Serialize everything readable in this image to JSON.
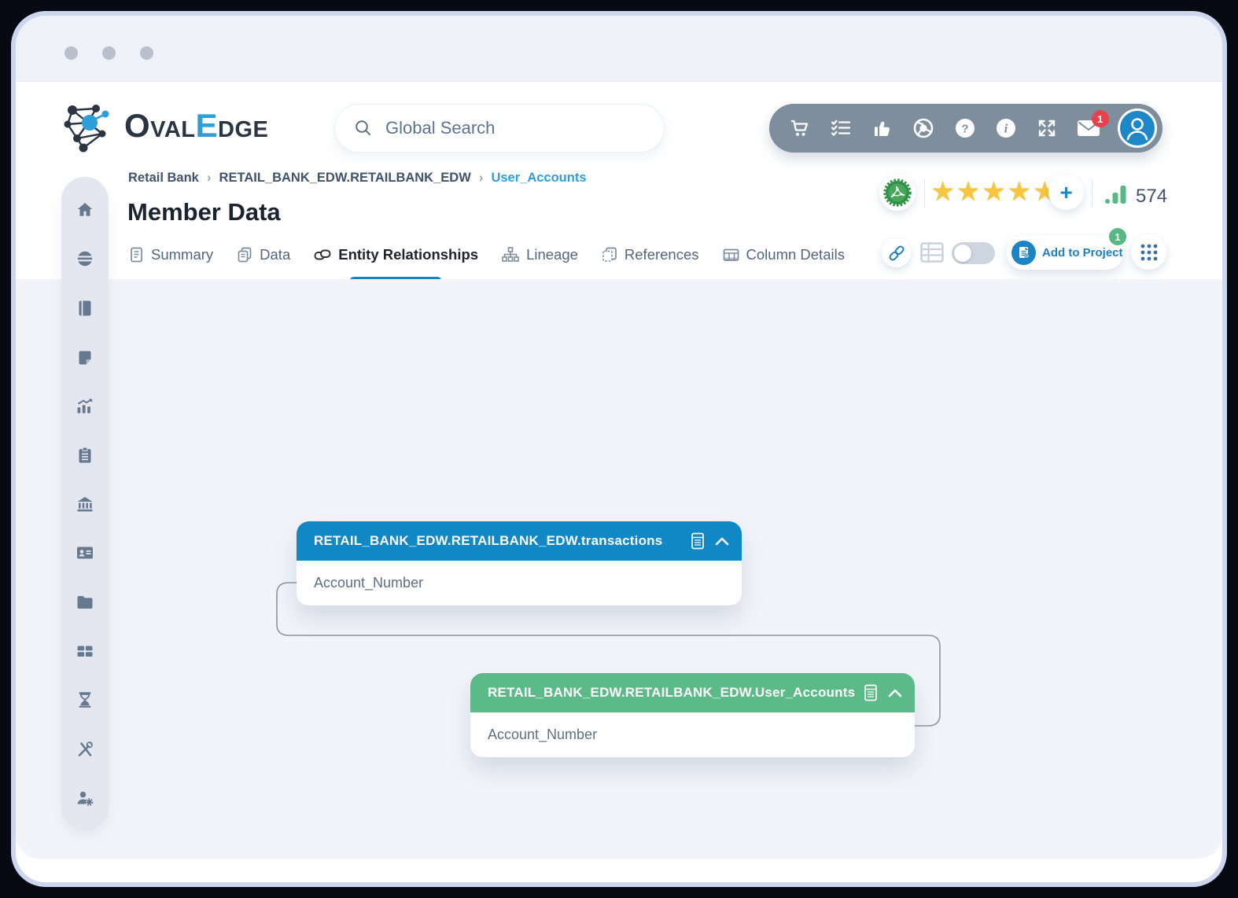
{
  "brand": {
    "part1": "Oval",
    "accent": "E",
    "part2": "dge"
  },
  "search": {
    "placeholder": "Global Search"
  },
  "toolbar": {
    "icons": [
      "cart",
      "tasks",
      "thumbs-up",
      "browser",
      "help",
      "info",
      "fullscreen",
      "mail",
      "profile"
    ],
    "mail_badge": "1"
  },
  "breadcrumb": {
    "separator": "›",
    "items": [
      {
        "label": "Retail Bank"
      },
      {
        "label": "RETAIL_BANK_EDW.RETAILBANK_EDW"
      },
      {
        "label": "User_Accounts"
      }
    ]
  },
  "page": {
    "title": "Member Data"
  },
  "tabs": [
    {
      "label": "Summary",
      "active": false
    },
    {
      "label": "Data",
      "active": false
    },
    {
      "label": "Entity Relationships",
      "active": true
    },
    {
      "label": "Lineage",
      "active": false
    },
    {
      "label": "References",
      "active": false
    },
    {
      "label": "Column Details",
      "active": false
    }
  ],
  "rating": {
    "star_glyph": "★",
    "stars": 5,
    "plus_glyph": "+",
    "count": "574"
  },
  "actions": {
    "toggle_state": "off",
    "add_to_project_label": "Add to Project",
    "project_badge": "1"
  },
  "sidebar": {
    "items": [
      "home",
      "data-catalog",
      "book",
      "notes",
      "reports",
      "clipboard",
      "governance",
      "contacts",
      "files",
      "dashboard",
      "history",
      "tools",
      "admin"
    ]
  },
  "diagram": {
    "cards": [
      {
        "title": "RETAIL_BANK_EDW.RETAILBANK_EDW.transactions",
        "header_color": "#1187c5",
        "columns": [
          "Account_Number"
        ]
      },
      {
        "title": "RETAIL_BANK_EDW.RETAILBANK_EDW.User_Accounts",
        "header_color": "#5cba88",
        "columns": [
          "Account_Number"
        ]
      }
    ],
    "relationship": {
      "from": "transactions.Account_Number",
      "to": "User_Accounts.Account_Number"
    }
  },
  "colors": {
    "accent_blue": "#1187c5",
    "accent_green": "#5cba88",
    "star_yellow": "#f6c63e",
    "badge_red": "#e8414d",
    "toolbar_gray": "#7e8e9d"
  }
}
